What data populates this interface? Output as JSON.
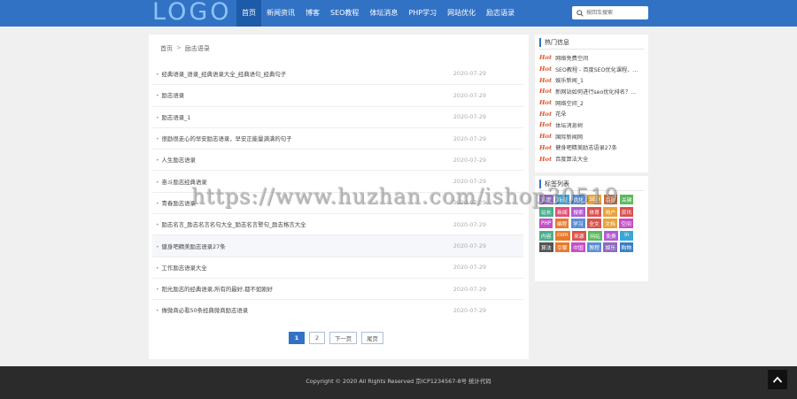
{
  "header": {
    "logo": "LOGO",
    "nav": [
      "首页",
      "新闻资讯",
      "博客",
      "SEO教程",
      "体坛消息",
      "PHP学习",
      "网站优化",
      "励志语录"
    ],
    "active_index": 0,
    "search_placeholder": "按回车搜索",
    "colors": {
      "bar": "#3272c5",
      "active": "#1d5aa8",
      "logo": "#8cc2f7"
    }
  },
  "breadcrumb": {
    "home": "首页",
    "separator": ">",
    "current": "励志语录"
  },
  "articles": [
    {
      "title": "经典语录_语录_经典语录大全_经典语句_经典句子",
      "date": "2020-07-29"
    },
    {
      "title": "励志语录",
      "date": "2020-07-29"
    },
    {
      "title": "励志语录_1",
      "date": "2020-07-29"
    },
    {
      "title": "很励很走心的早安励志语录，早安正能量满满的句子",
      "date": "2020-07-29"
    },
    {
      "title": "人生励志语录",
      "date": "2020-07-29"
    },
    {
      "title": "奋斗励志经典语录",
      "date": "2020-07-29"
    },
    {
      "title": "青春励志语录",
      "date": "2020-07-29"
    },
    {
      "title": "励志名言_励志名言名句大全_励志名言警句_励志格言大全",
      "date": "2020-07-29"
    },
    {
      "title": "健身吧精美励志语录27条",
      "date": "2020-07-29"
    },
    {
      "title": "工作励志语录大全",
      "date": "2020-07-29"
    },
    {
      "title": "阳光励志的经典语录,所有的最好,都不如刚好",
      "date": "2020-07-29"
    },
    {
      "title": "做微商必看50条经典微商励志语录",
      "date": "2020-07-29"
    }
  ],
  "pagination": {
    "current": "1",
    "next_page": "2",
    "next": "下一页",
    "last": "尾页"
  },
  "hot": {
    "title": "热门信息",
    "badge": "Hot",
    "items": [
      "网络免费空间",
      "SEO教程 - 百度SEO优化课程、...",
      "娱乐新闻_1",
      "新网站如何进行seo优化排名？...",
      "网络空间_2",
      "花朵",
      "体坛消息树",
      "国际新闻网",
      "健身吧精美励志语录27条",
      "百度算法大全"
    ]
  },
  "tag_list": {
    "title": "标签列表",
    "tags": [
      {
        "label": "百度",
        "color": "#8e6bbf"
      },
      {
        "label": "新闻",
        "color": "#3aa6d8"
      },
      {
        "label": "优化",
        "color": "#5a8fd6"
      },
      {
        "label": "SEO",
        "color": "#e8a33c"
      },
      {
        "label": "百度",
        "color": "#c96b3d"
      },
      {
        "label": "关键",
        "color": "#5cb85c"
      },
      {
        "label": "站长",
        "color": "#4cae8c"
      },
      {
        "label": "新闻",
        "color": "#e24f7a"
      },
      {
        "label": "搜索",
        "color": "#b45bd2"
      },
      {
        "label": "体育",
        "color": "#d9534f"
      },
      {
        "label": "用户",
        "color": "#e8a33c"
      },
      {
        "label": "资讯",
        "color": "#d94f4f"
      },
      {
        "label": "PHP",
        "color": "#c64fc8"
      },
      {
        "label": "编程",
        "color": "#e77a2a"
      },
      {
        "label": "学习",
        "color": "#5a8fd6"
      },
      {
        "label": "全文",
        "color": "#d9534f"
      },
      {
        "label": "文档",
        "color": "#e8a33c"
      },
      {
        "label": "空间",
        "color": "#c64fc8"
      },
      {
        "label": "内容",
        "color": "#4cae8c"
      },
      {
        "label": "com",
        "color": "#e77a2a"
      },
      {
        "label": "来源",
        "color": "#d9534f"
      },
      {
        "label": "网站",
        "color": "#5cb85c"
      },
      {
        "label": "免费",
        "color": "#b45bd2"
      },
      {
        "label": "in",
        "color": "#3aa6d8"
      },
      {
        "label": "算法",
        "color": "#555555"
      },
      {
        "label": "引擎",
        "color": "#e77a2a"
      },
      {
        "label": "中国",
        "color": "#c64fc8"
      },
      {
        "label": "教程",
        "color": "#5a8fd6"
      },
      {
        "label": "娱乐",
        "color": "#8e6bbf"
      },
      {
        "label": "购物",
        "color": "#3a7fc4"
      }
    ]
  },
  "footer": {
    "copyright": "Copyright © 2020 All Rights Reserved 京ICP1234567-8号 统计代码"
  },
  "watermark": "https://www.huzhan.com/ishop30519"
}
